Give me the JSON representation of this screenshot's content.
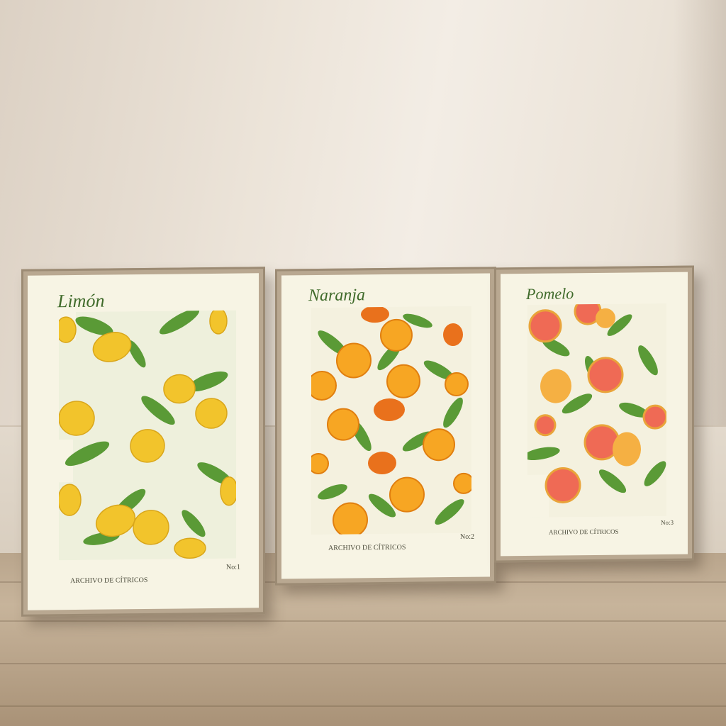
{
  "scene": {
    "description_colors": {
      "wall": "#ece4d9",
      "floor": "#c7b49b",
      "frame": "#b9a891",
      "mat": "#f7f4e4",
      "title_green": "#3f6a2a"
    }
  },
  "posters": [
    {
      "title": "Limón",
      "footer": "ARCHIVO DE CÍTRICOS",
      "number": "No:1",
      "fruit_icon": "lemon-icon",
      "fruit_color": "#f2c42c"
    },
    {
      "title": "Naranja",
      "footer": "ARCHIVO DE CÍTRICOS",
      "number": "No:2",
      "fruit_icon": "orange-icon",
      "fruit_color": "#f29a1e"
    },
    {
      "title": "Pomelo",
      "footer": "ARCHIVO DE CÍTRICOS",
      "number": "No:3",
      "fruit_icon": "grapefruit-icon",
      "fruit_color": "#e8604a"
    }
  ]
}
